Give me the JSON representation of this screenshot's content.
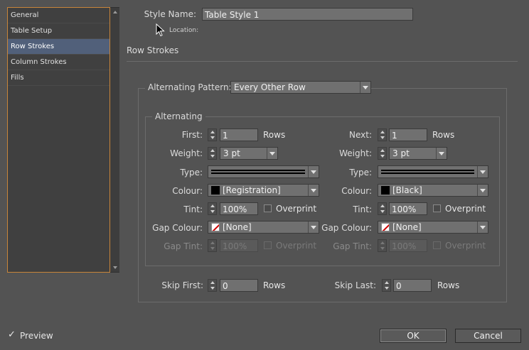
{
  "categories": [
    {
      "label": "General",
      "selected": false
    },
    {
      "label": "Table Setup",
      "selected": false
    },
    {
      "label": "Row Strokes",
      "selected": true
    },
    {
      "label": "Column Strokes",
      "selected": false
    },
    {
      "label": "Fills",
      "selected": false
    }
  ],
  "style_name": {
    "label": "Style Name:",
    "value": "Table Style 1"
  },
  "location_label": "Location:",
  "section_title": "Row Strokes",
  "alternating_pattern": {
    "label": "Alternating Pattern:",
    "value": "Every Other Row"
  },
  "alternating_group_title": "Alternating",
  "first": {
    "count_label": "First:",
    "count_value": "1",
    "unit": "Rows",
    "weight_label": "Weight:",
    "weight_value": "3 pt",
    "type_label": "Type:",
    "colour_label": "Colour:",
    "colour_value": "[Registration]",
    "tint_label": "Tint:",
    "tint_value": "100%",
    "overprint_label": "Overprint",
    "gap_colour_label": "Gap Colour:",
    "gap_colour_value": "[None]",
    "gap_tint_label": "Gap Tint:",
    "gap_tint_value": "100%",
    "gap_overprint_label": "Overprint"
  },
  "next": {
    "count_label": "Next:",
    "count_value": "1",
    "unit": "Rows",
    "weight_label": "Weight:",
    "weight_value": "3 pt",
    "type_label": "Type:",
    "colour_label": "Colour:",
    "colour_value": "[Black]",
    "tint_label": "Tint:",
    "tint_value": "100%",
    "overprint_label": "Overprint",
    "gap_colour_label": "Gap Colour:",
    "gap_colour_value": "[None]",
    "gap_tint_label": "Gap Tint:",
    "gap_tint_value": "100%",
    "gap_overprint_label": "Overprint"
  },
  "skip_first": {
    "label": "Skip First:",
    "value": "0",
    "unit": "Rows"
  },
  "skip_last": {
    "label": "Skip Last:",
    "value": "0",
    "unit": "Rows"
  },
  "preview": {
    "label": "Preview",
    "checked": true
  },
  "buttons": {
    "ok": "OK",
    "cancel": "Cancel"
  },
  "colors": {
    "accent_border": "#c8853a",
    "selected_row": "#51607a",
    "background": "#535353"
  }
}
